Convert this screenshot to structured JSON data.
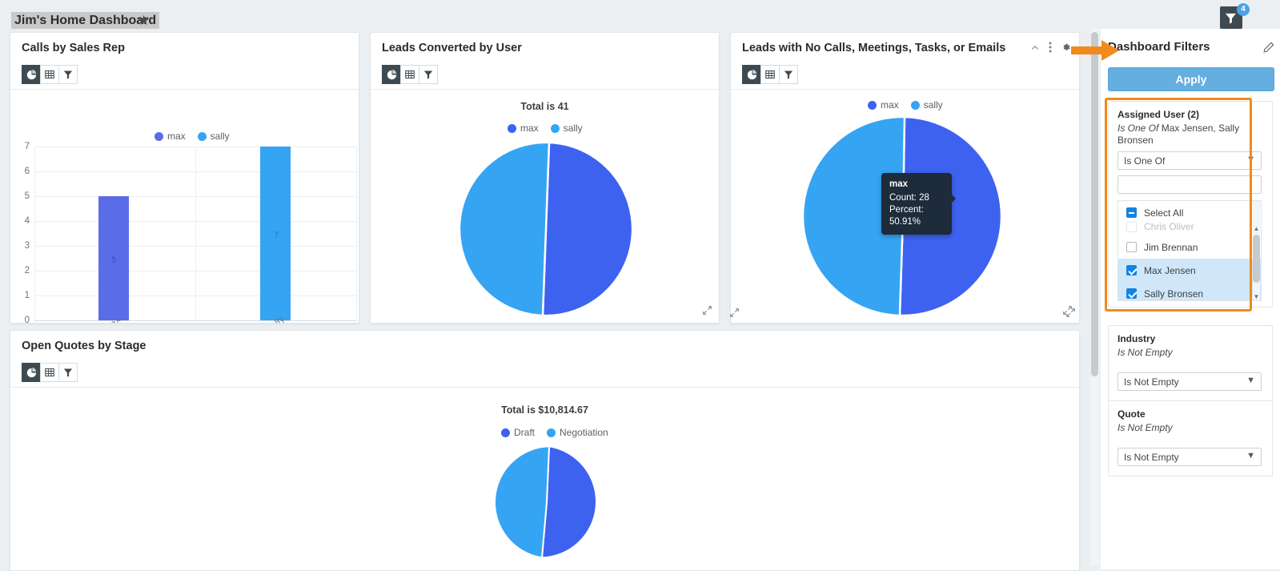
{
  "topbar": {
    "dashboard_title": "Jim's Home Dashboard",
    "star_icon": "star-icon",
    "filter_toggle_icon": "filter-icon",
    "filter_badge_count": "4"
  },
  "colors": {
    "series_indigo": "#3e62f0",
    "series_lightblue": "#35a4f3",
    "accent_orange": "#f08a1c",
    "apply_blue": "#64aee0",
    "checkbox_blue": "#1384e3"
  },
  "panels": [
    {
      "id": "calls-by-sales-rep",
      "title": "Calls by Sales Rep",
      "tools": [
        "chart-icon",
        "table-icon",
        "filter-icon"
      ],
      "head_icons": [],
      "resize_handle": false
    },
    {
      "id": "leads-converted-by-user",
      "title": "Leads Converted by User",
      "tools": [
        "chart-icon",
        "table-icon",
        "filter-icon"
      ],
      "head_icons": [],
      "resize_handle": true
    },
    {
      "id": "leads-no-activity",
      "title": "Leads with No Calls, Meetings, Tasks, or Emails",
      "tools": [
        "chart-icon",
        "table-icon",
        "filter-icon"
      ],
      "head_icons": [
        "chevron-up-icon",
        "kebab-menu-icon",
        "gear-icon"
      ],
      "resize_handle": true
    },
    {
      "id": "open-quotes-by-stage",
      "title": "Open Quotes by Stage",
      "tools": [
        "chart-icon",
        "table-icon",
        "filter-icon"
      ],
      "head_icons": [],
      "resize_handle": false
    }
  ],
  "chart_data": [
    {
      "type": "bar",
      "panel": "Calls by Sales Rep",
      "title": "",
      "categories": [
        "max",
        "sally"
      ],
      "values": [
        5,
        7
      ],
      "series": [
        {
          "name": "max",
          "values": [
            5
          ],
          "color": "#5b6ce8"
        },
        {
          "name": "sally",
          "values": [
            7
          ],
          "color": "#35a4f3"
        }
      ],
      "legend": [
        "max",
        "sally"
      ],
      "legend_position": "top",
      "xlabel": "",
      "ylabel": "",
      "ylim": [
        0,
        7
      ],
      "yticks": [
        0,
        1,
        2,
        3,
        4,
        5,
        6,
        7
      ],
      "data_labels": [
        "5",
        "7"
      ],
      "grid": true
    },
    {
      "type": "pie",
      "panel": "Leads Converted by User",
      "title": "Total is 41",
      "total": "41",
      "labels": [
        "max",
        "sally"
      ],
      "values": [
        21,
        20
      ],
      "percents": [
        51.2,
        48.8
      ],
      "colors": [
        "#3e62f0",
        "#35a4f3"
      ],
      "legend": [
        "max",
        "sally"
      ],
      "legend_position": "top"
    },
    {
      "type": "pie",
      "panel": "Leads with No Calls, Meetings, Tasks, or Emails",
      "title": "",
      "labels": [
        "max",
        "sally"
      ],
      "values": [
        28,
        27
      ],
      "percents": [
        50.91,
        49.09
      ],
      "colors": [
        "#3e62f0",
        "#35a4f3"
      ],
      "legend": [
        "max",
        "sally"
      ],
      "legend_position": "top",
      "tooltip": {
        "title": "max",
        "count_label": "Count: 28",
        "percent_label": "Percent: 50.91%"
      }
    },
    {
      "type": "pie",
      "panel": "Open Quotes by Stage",
      "title": "Total is $10,814.67",
      "total": "$10,814.67",
      "labels": [
        "Draft",
        "Negotiation"
      ],
      "values": [
        5623.63,
        5191.04
      ],
      "percents": [
        52.0,
        48.0
      ],
      "colors": [
        "#3e62f0",
        "#35a4f3"
      ],
      "legend": [
        "Draft",
        "Negotiation"
      ],
      "legend_position": "top"
    }
  ],
  "filters_panel": {
    "heading": "Dashboard Filters",
    "edit_icon": "pencil-icon",
    "apply_label": "Apply",
    "filters": [
      {
        "label": "Assigned User (2)",
        "operator_text": "Is One Of",
        "value_text": "Max Jensen, Sally Bronsen",
        "select_value": "Is One Of",
        "search_value": "",
        "options": [
          {
            "label": "Select All",
            "state": "indeterminate",
            "selected": false
          },
          {
            "label": "Chris Oliver",
            "state": "unchecked",
            "selected": false
          },
          {
            "label": "Jim Brennan",
            "state": "unchecked",
            "selected": false
          },
          {
            "label": "Max Jensen",
            "state": "checked",
            "selected": true
          },
          {
            "label": "Sally Bronsen",
            "state": "checked",
            "selected": true
          }
        ]
      },
      {
        "label": "Industry",
        "operator_text": "Is Not Empty",
        "value_text": "",
        "select_value": "Is Not Empty"
      },
      {
        "label": "Quote",
        "operator_text": "Is Not Empty",
        "value_text": "",
        "select_value": "Is Not Empty"
      }
    ]
  }
}
